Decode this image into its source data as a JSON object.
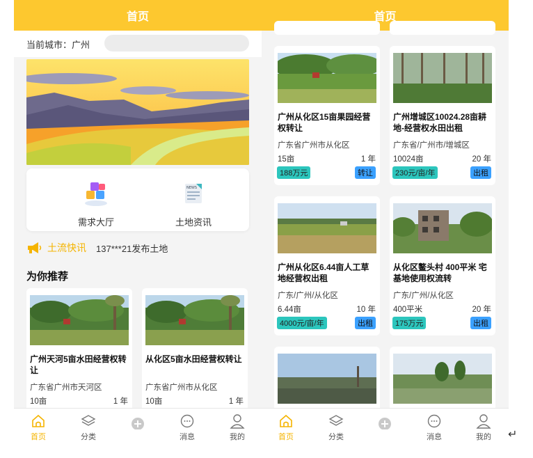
{
  "left": {
    "header": {
      "title": "首页"
    },
    "city": {
      "label": "当前城市：广州"
    },
    "nav": [
      {
        "label": "需求大厅"
      },
      {
        "label": "土地资讯",
        "badge": "NEWS"
      }
    ],
    "flash": {
      "title": "土流快讯",
      "text": "137***21发布土地"
    },
    "recommend_title": "为你推荐",
    "cards": [
      {
        "title": "广州天河5亩水田经营权转让",
        "location": "广东省广州市天河区",
        "area": "10亩",
        "years": "1 年"
      },
      {
        "title": "从化区5亩水田经营权转让",
        "location": "广东省广州市从化区",
        "area": "10亩",
        "years": "1 年"
      }
    ]
  },
  "right": {
    "header": {
      "title": "首页"
    },
    "cards": [
      {
        "title": "广州从化区15亩果园经营权转让",
        "location": "广东省广州市从化区",
        "area": "15亩",
        "years": "1 年",
        "price": "188万元",
        "tag": "转让"
      },
      {
        "title": "广州增城区10024.28亩耕地-经营权水田出租",
        "location": "广东省/广州市/增城区",
        "area": "10024亩",
        "years": "20 年",
        "price": "230元/亩/年",
        "tag": "出租"
      },
      {
        "title": "广州从化区6.44亩人工草地经营权出租",
        "location": "广东/广州/从化区",
        "area": "6.44亩",
        "years": "10 年",
        "price": "4000元/亩/年",
        "tag": "出租"
      },
      {
        "title": "从化区鳌头村 400平米 宅基地使用权流转",
        "location": "广东/广州/从化区",
        "area": "400平米",
        "years": "20 年",
        "price": "175万元",
        "tag": "出租"
      }
    ]
  },
  "tabbar": {
    "items": [
      {
        "label": "首页",
        "icon": "home-icon"
      },
      {
        "label": "分类",
        "icon": "layers-icon"
      },
      {
        "label": "",
        "icon": "plus-circle-icon"
      },
      {
        "label": "消息",
        "icon": "chat-icon"
      },
      {
        "label": "我的",
        "icon": "user-icon"
      }
    ]
  },
  "colors": {
    "brand": "#fdc82f",
    "price_bg": "#2cc6bd",
    "tag_bg": "#3ba1ff",
    "active_tab": "#f5b400"
  }
}
